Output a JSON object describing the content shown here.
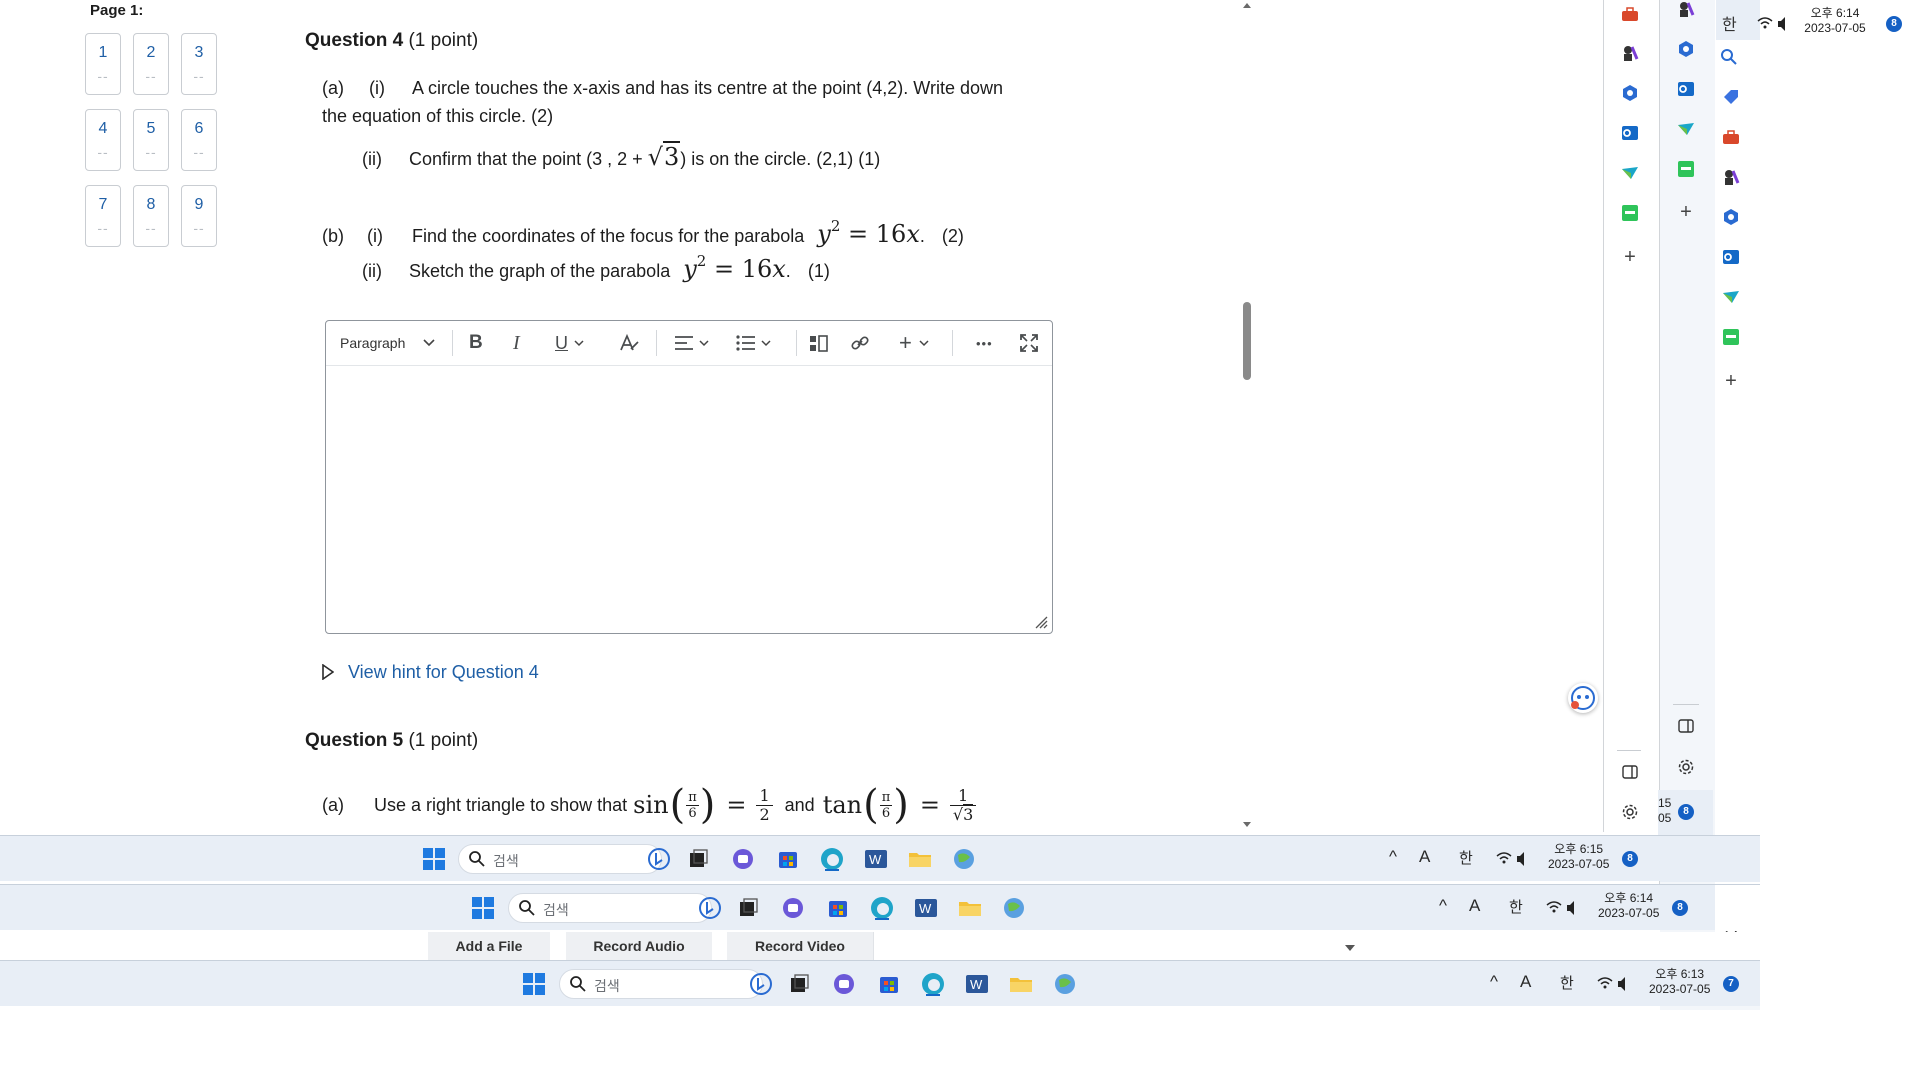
{
  "nav": {
    "page_label": "Page 1:",
    "items": [
      {
        "num": "1",
        "status": "--"
      },
      {
        "num": "2",
        "status": "--"
      },
      {
        "num": "3",
        "status": "--"
      },
      {
        "num": "4",
        "status": "--"
      },
      {
        "num": "5",
        "status": "--"
      },
      {
        "num": "6",
        "status": "--"
      },
      {
        "num": "7",
        "status": "--"
      },
      {
        "num": "8",
        "status": "--"
      },
      {
        "num": "9",
        "status": "--"
      }
    ]
  },
  "q4": {
    "title": "Question 4",
    "points": "(1 point)",
    "a_label": "(a)",
    "ai_label": "(i)",
    "ai_text_1": "A circle touches the x-axis and has its centre at the point (4,2). Write down",
    "ai_text_2": "the equation of this circle.   (2)",
    "aii_label": "(ii)",
    "aii_pre": "Confirm that the point (3 , 2 +",
    "aii_root": "3",
    "aii_post": ") is on the circle. (2,1)   (1)",
    "b_label": "(b)",
    "bi_label": "(i)",
    "bi_text": "Find the coordinates of the focus for the parabola",
    "bi_marks": "(2)",
    "bii_label": "(ii)",
    "bii_text": "Sketch the graph of the parabola",
    "bii_marks": "(1)",
    "eq_lhs": "y",
    "eq_exp": "2",
    "eq_rhs": "= 16",
    "eq_var": "x",
    "eq_end": "."
  },
  "editor": {
    "paragraph": "Paragraph",
    "bold": "B",
    "italic": "I",
    "underline": "U",
    "more": "•••",
    "plus": "+"
  },
  "hint": {
    "text": "View hint for Question 4"
  },
  "q5": {
    "title": "Question 5",
    "points": "(1 point)",
    "a_label": "(a)",
    "a_text": "Use a right triangle to show that",
    "sin": "sin",
    "tan": "tan",
    "pi": "π",
    "six": "6",
    "half_num": "1",
    "half_den": "2",
    "and": "and",
    "one": "1",
    "sqrt3": "3",
    "eq": "="
  },
  "attachments": {
    "add_file": "Add a File",
    "record_audio": "Record Audio",
    "record_video": "Record Video"
  },
  "taskbars": {
    "search": "검색",
    "ime": "한",
    "font": "A",
    "caret": "^",
    "top": {
      "time": "오후 6:15",
      "date": "2023-07-05",
      "badge": "8"
    },
    "mid": {
      "time": "오후 6:14",
      "date": "2023-07-05",
      "badge": "8"
    },
    "bottom": {
      "time": "오후 6:13",
      "date": "2023-07-05",
      "badge": "7"
    },
    "corner": {
      "time": "오후 6:14",
      "date": "2023-07-05",
      "badge": "8"
    },
    "partial": {
      "time": "15",
      "date": "05",
      "badge": "8"
    }
  },
  "colors": {
    "link": "#1f5fa6",
    "taskbar": "#e8eef6",
    "badge": "#1560c4"
  }
}
